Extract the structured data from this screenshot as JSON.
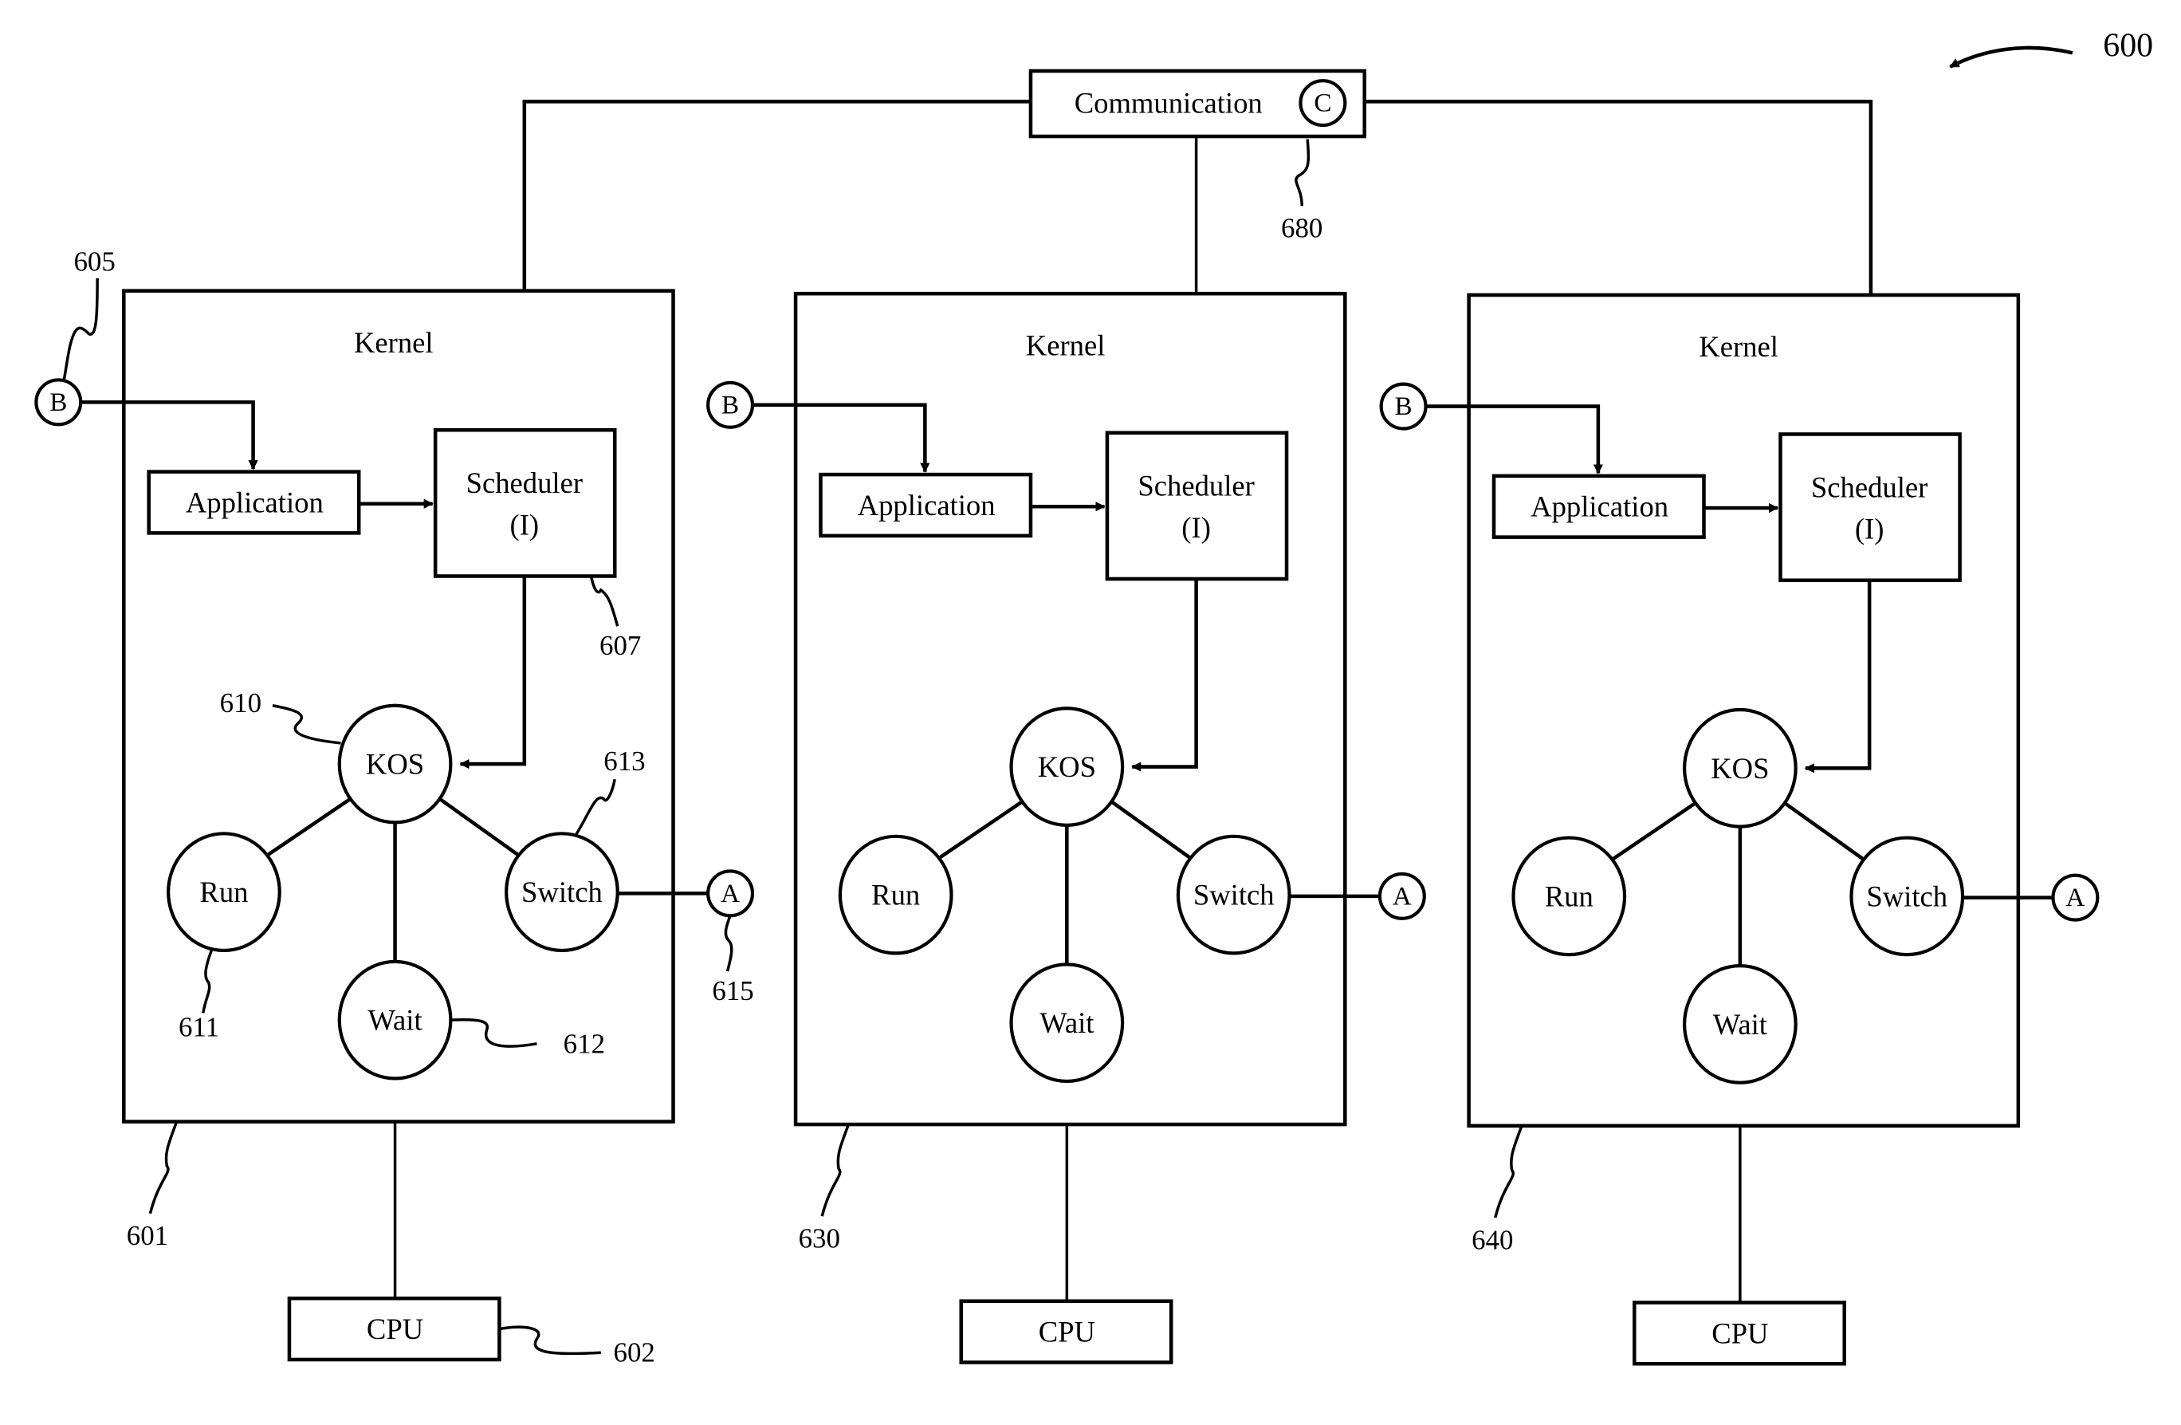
{
  "figure": {
    "number": "600",
    "communication": {
      "label": "Communication",
      "connector": "C",
      "ref": "680"
    },
    "kernels": [
      {
        "title": "Kernel",
        "ref": "601",
        "input_connector": "B",
        "input_ref": "605",
        "application": "Application",
        "scheduler": {
          "line1": "Scheduler",
          "line2": "(I)",
          "ref": "607"
        },
        "states": {
          "kos": {
            "label": "KOS",
            "ref": "610"
          },
          "run": {
            "label": "Run",
            "ref": "611"
          },
          "wait": {
            "label": "Wait",
            "ref": "612"
          },
          "switch": {
            "label": "Switch",
            "ref": "613"
          }
        },
        "output_connector": "A",
        "output_ref": "615",
        "cpu": {
          "label": "CPU",
          "ref": "602"
        }
      },
      {
        "title": "Kernel",
        "ref": "630",
        "input_connector": "B",
        "application": "Application",
        "scheduler": {
          "line1": "Scheduler",
          "line2": "(I)"
        },
        "states": {
          "kos": {
            "label": "KOS"
          },
          "run": {
            "label": "Run"
          },
          "wait": {
            "label": "Wait"
          },
          "switch": {
            "label": "Switch"
          }
        },
        "output_connector": "A",
        "cpu": {
          "label": "CPU"
        }
      },
      {
        "title": "Kernel",
        "ref": "640",
        "input_connector": "B",
        "application": "Application",
        "scheduler": {
          "line1": "Scheduler",
          "line2": "(I)"
        },
        "states": {
          "kos": {
            "label": "KOS"
          },
          "run": {
            "label": "Run"
          },
          "wait": {
            "label": "Wait"
          },
          "switch": {
            "label": "Switch"
          }
        },
        "output_connector": "A",
        "cpu": {
          "label": "CPU"
        }
      }
    ]
  }
}
